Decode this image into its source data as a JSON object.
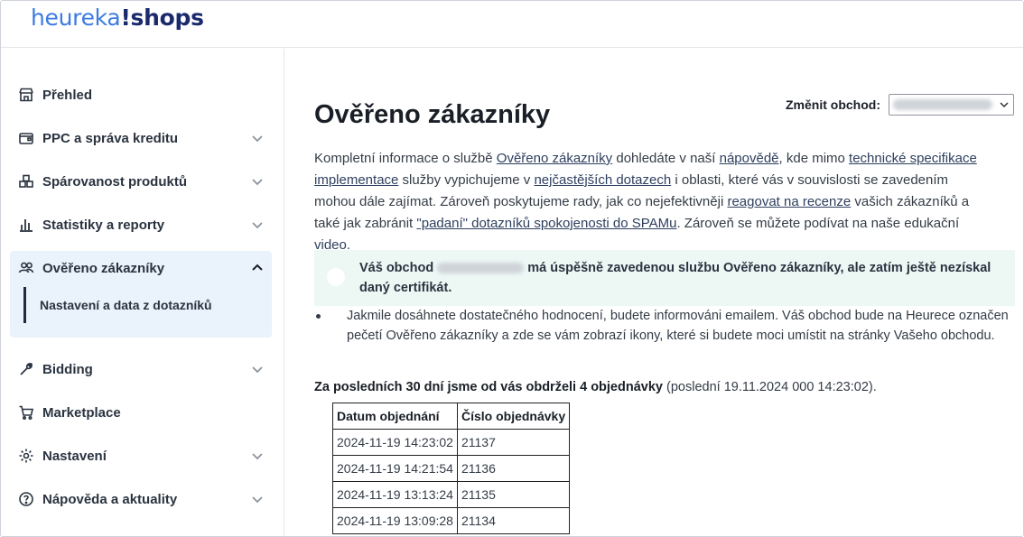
{
  "logo": {
    "part1": "heureka",
    "part2": "!shops"
  },
  "sidebar": {
    "items": [
      {
        "label": "Přehled",
        "icon": "store-icon",
        "has_chevron": false
      },
      {
        "label": "PPC a správa kreditu",
        "icon": "wallet-icon",
        "has_chevron": true
      },
      {
        "label": "Spárovanost produktů",
        "icon": "boxes-icon",
        "has_chevron": true
      },
      {
        "label": "Statistiky a reporty",
        "icon": "bar-chart-icon",
        "has_chevron": true
      },
      {
        "label": "Ověřeno zákazníky",
        "icon": "users-icon",
        "has_chevron": true,
        "expanded": true
      },
      {
        "label": "Bidding",
        "icon": "wrench-icon",
        "has_chevron": true
      },
      {
        "label": "Marketplace",
        "icon": "cart-icon",
        "has_chevron": false
      },
      {
        "label": "Nastavení",
        "icon": "gear-icon",
        "has_chevron": true
      },
      {
        "label": "Nápověda a aktuality",
        "icon": "help-icon",
        "has_chevron": true
      }
    ],
    "subitem": "Nastavení a data z dotazníků"
  },
  "main": {
    "title": "Ověřeno zákazníky",
    "switch_label": "Změnit obchod:",
    "intro": {
      "t1": "Kompletní informace o službě ",
      "l1": "Ověřeno zákazníky",
      "t2": " dohledáte v naší ",
      "l2": "nápovědě",
      "t3": ", kde mimo ",
      "l3": "technické specifikace implementace",
      "t4": " služby vypichujeme v ",
      "l4": "nejčastějších dotazech",
      "t5": " i oblasti, které vás v souvislosti se zavedením mohou dále zajímat. Zároveň poskytujeme rady, jak co nejefektivněji ",
      "l5": "reagovat na recenze",
      "t6": " vašich zákazníků a také jak zabránit ",
      "l6": "\"padaní\" dotazníků spokojenosti do SPAMu",
      "t7": ". Zároveň se můžete podívat na naše edukační ",
      "l7": "video",
      "t8": "."
    },
    "notice": {
      "before": "Váš obchod ",
      "after": " má úspěšně zavedenou službu Ověřeno zákazníky, ale zatím ještě nezískal daný certifikát."
    },
    "bullet": "Jakmile dosáhnete dostatečného hodnocení, budete informováni emailem. Váš obchod bude na Heurece označen pečetí Ověřeno zákazníky a zde se vám zobrazí ikony, které si budete moci umístit na stránky Vašeho obchodu.",
    "summary_bold": "Za posledních 30 dní jsme od vás obdrželi 4 objednávky",
    "summary_rest": " (poslední 19.11.2024 000 14:23:02).",
    "table": {
      "headers": [
        "Datum objednání",
        "Číslo objednávky"
      ],
      "rows": [
        [
          "2024-11-19 14:23:02",
          "21137"
        ],
        [
          "2024-11-19 14:21:54",
          "21136"
        ],
        [
          "2024-11-19 13:13:24",
          "21135"
        ],
        [
          "2024-11-19 13:09:28",
          "21134"
        ]
      ]
    }
  }
}
